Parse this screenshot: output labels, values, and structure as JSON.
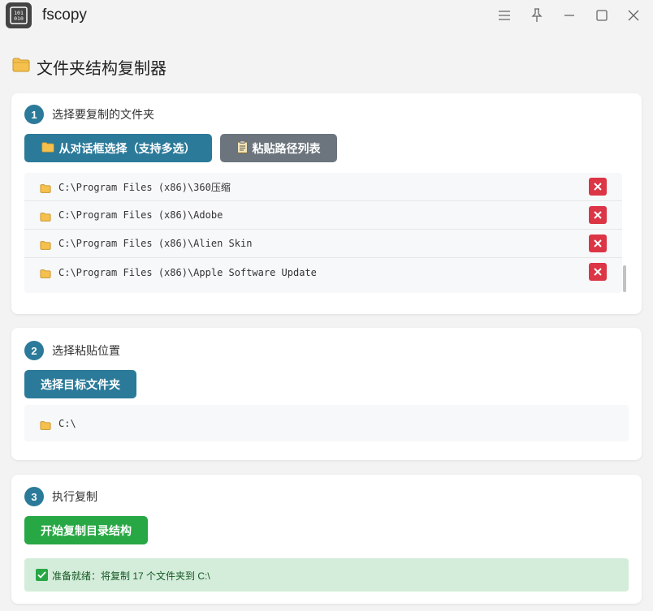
{
  "window": {
    "title": "fscopy"
  },
  "page": {
    "title": "文件夹结构复制器"
  },
  "step1": {
    "number": "1",
    "label": "选择要复制的文件夹",
    "select_button": "从对话框选择（支持多选）",
    "paste_button": "粘贴路径列表",
    "folders": [
      "C:\\Program Files (x86)\\360压缩",
      "C:\\Program Files (x86)\\Adobe",
      "C:\\Program Files (x86)\\Alien Skin",
      "C:\\Program Files (x86)\\Apple Software Update"
    ]
  },
  "step2": {
    "number": "2",
    "label": "选择粘贴位置",
    "select_button": "选择目标文件夹",
    "target_path": "C:\\"
  },
  "step3": {
    "number": "3",
    "label": "执行复制",
    "start_button": "开始复制目录结构",
    "status": "准备就绪：将复制 17 个文件夹到 C:\\"
  },
  "icons": {
    "folder": "folder-icon",
    "clipboard": "clipboard-icon",
    "delete": "close-icon",
    "check": "check-icon"
  },
  "colors": {
    "primary": "#2b7a99",
    "secondary": "#6c757d",
    "success": "#28a745",
    "danger": "#dc3545",
    "success_bg": "#d4edda"
  }
}
